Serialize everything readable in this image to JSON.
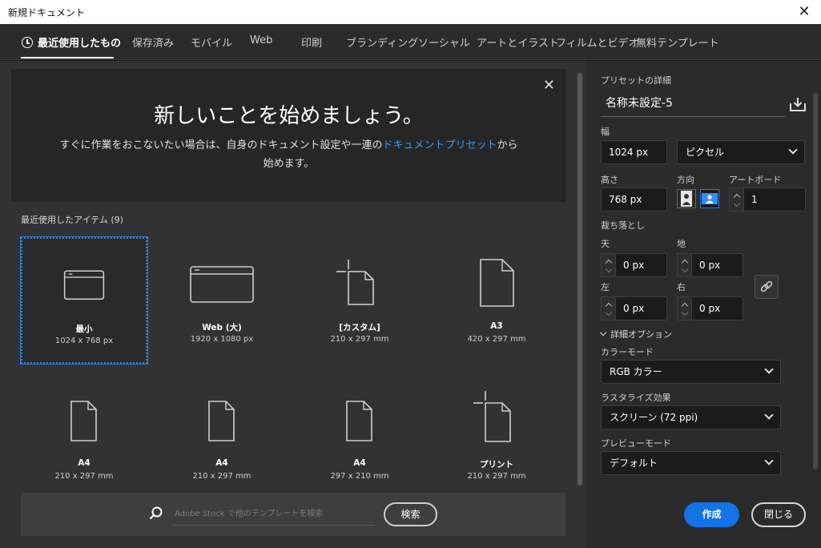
{
  "window": {
    "title": "新規ドキュメント",
    "close_glyph": "✕"
  },
  "tabs": [
    {
      "label": "最近使用したもの",
      "icon": "clock-icon",
      "active": true
    },
    {
      "label": "保存済み"
    },
    {
      "label": "モバイル"
    },
    {
      "label": "Web"
    },
    {
      "label": "印刷"
    },
    {
      "label": "ブランディング"
    },
    {
      "label": "ソーシャル"
    },
    {
      "label": "アートとイラスト"
    },
    {
      "label": "フィルムとビデオ"
    },
    {
      "label": "無料テンプレート"
    }
  ],
  "welcome": {
    "heading": "新しいことを始めましょう。",
    "desc_before": "すぐに作業をおこないたい場合は、自身のドキュメント設定や一連の",
    "desc_link": "ドキュメントプリセット",
    "desc_after": "から始めます。",
    "close_glyph": "✕"
  },
  "recent": {
    "title": "最近使用したアイテム (9)",
    "items": [
      {
        "name": "最小",
        "size": "1024 x 768 px",
        "icon": "screen-icon",
        "selected": true
      },
      {
        "name": "Web (大)",
        "size": "1920 x 1080 px",
        "icon": "wide-screen-icon"
      },
      {
        "name": "[カスタム]",
        "size": "210 x 297 mm",
        "icon": "document-custom-icon"
      },
      {
        "name": "A3",
        "size": "420 x 297 mm",
        "icon": "document-icon"
      },
      {
        "name": "A4",
        "size": "210 x 297 mm",
        "icon": "document-icon"
      },
      {
        "name": "A4",
        "size": "210 x 297 mm",
        "icon": "document-icon"
      },
      {
        "name": "A4",
        "size": "297 x 210 mm",
        "icon": "document-icon"
      },
      {
        "name": "プリント",
        "size": "210 x 297 mm",
        "icon": "document-custom-icon"
      }
    ]
  },
  "stock": {
    "placeholder": "Adobe Stock で他のテンプレートを検索",
    "search_label": "検索"
  },
  "preset": {
    "section_label": "プリセットの詳細",
    "name": "名称未設定-5",
    "width_label": "幅",
    "width_value": "1024 px",
    "unit": "ピクセル",
    "height_label": "高さ",
    "height_value": "768 px",
    "orientation_label": "方向",
    "artboard_label": "アートボード",
    "artboard_value": "1",
    "bleed_label": "裁ち落とし",
    "bleed_top_label": "天",
    "bleed_top_value": "0 px",
    "bleed_bottom_label": "地",
    "bleed_bottom_value": "0 px",
    "bleed_left_label": "左",
    "bleed_left_value": "0 px",
    "bleed_right_label": "右",
    "bleed_right_value": "0 px",
    "advanced_label": "詳細オプション",
    "color_mode_label": "カラーモード",
    "color_mode_value": "RGB カラー",
    "raster_label": "ラスタライズ効果",
    "raster_value": "スクリーン (72 ppi)",
    "preview_label": "プレビューモード",
    "preview_value": "デフォルト",
    "create_label": "作成",
    "close_label": "閉じる"
  },
  "colors": {
    "accent": "#1473e6",
    "link": "#3b9cf5",
    "selection": "#2f7fd6"
  }
}
